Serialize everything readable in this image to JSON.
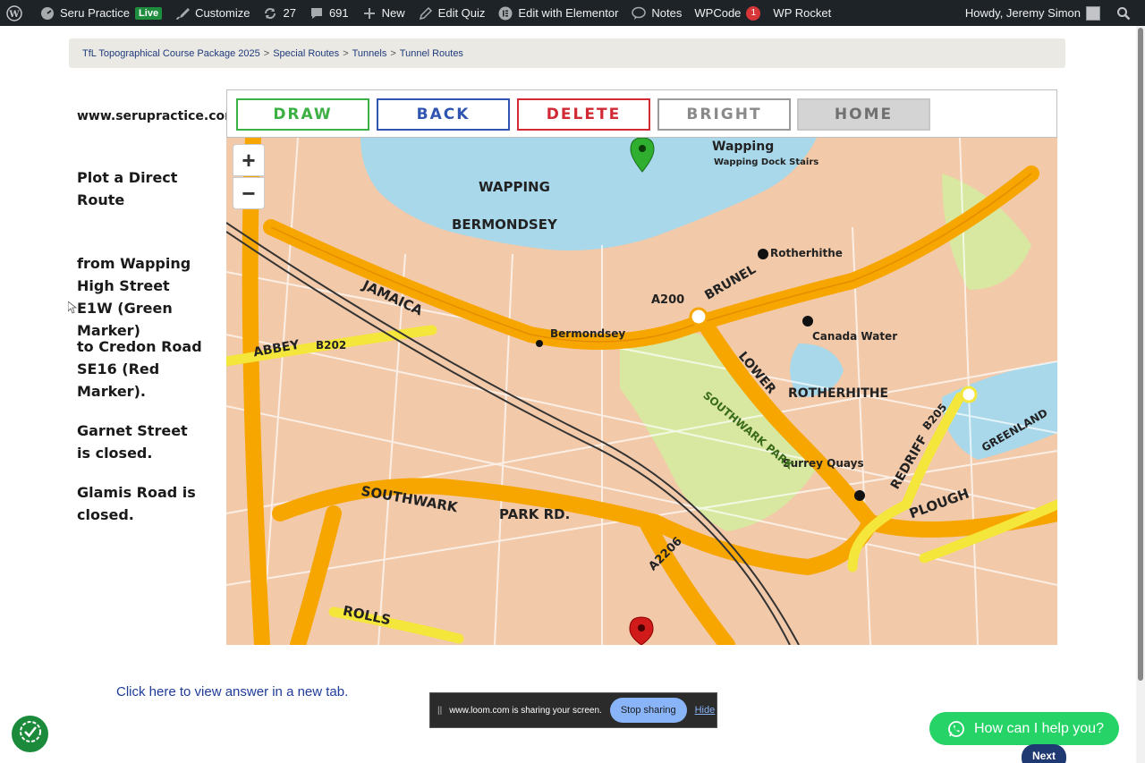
{
  "adminbar": {
    "items": [
      {
        "icon": "wordpress-icon",
        "label": ""
      },
      {
        "icon": "dashboard-icon",
        "label": "Seru Practice",
        "badge": "Live"
      },
      {
        "icon": "brush-icon",
        "label": "Customize"
      },
      {
        "icon": "updates-icon",
        "label": "27"
      },
      {
        "icon": "comment-icon",
        "label": "691"
      },
      {
        "icon": "plus-icon",
        "label": "New"
      },
      {
        "icon": "pencil-icon",
        "label": "Edit Quiz"
      },
      {
        "icon": "elementor-icon",
        "label": "Edit with Elementor"
      },
      {
        "icon": "notes-icon",
        "label": "Notes"
      },
      {
        "icon": "",
        "label": "WPCode",
        "badge": "1"
      },
      {
        "icon": "",
        "label": "WP Rocket"
      }
    ],
    "greeting": "Howdy, Jeremy Simon"
  },
  "breadcrumb": [
    "TfL Topographical Course Package 2025",
    "Special Routes",
    "Tunnels",
    "Tunnel Routes"
  ],
  "left": {
    "site_url": "www.serupractice.com",
    "instruction": "Plot a Direct Route",
    "from": "from Wapping High Street E1W (Green Marker)",
    "to": "to Credon Road SE16 (Red Marker).",
    "closure1": "Garnet Street is closed.",
    "closure2": "Glamis Road is closed."
  },
  "toolbar": {
    "draw": "DRAW",
    "back": "BACK",
    "delete": "DELETE",
    "bright": "BRIGHT",
    "home": "HOME"
  },
  "map": {
    "zoom_in": "+",
    "zoom_out": "−",
    "labels": {
      "wapping_station": "Wapping",
      "wapping_dock": "Wapping Dock Stairs",
      "wapping_area": "WAPPING",
      "bermondsey_area": "BERMONDSEY",
      "rotherhithe_station": "Rotherhithe",
      "canada_water": "Canada Water",
      "rotherhithe_area": "ROTHERHITHE",
      "bermondsey_station": "Bermondsey",
      "southwark_park": "SOUTHWARK PARK",
      "surrey_quays": "Surrey Quays",
      "lower_road": "LOWER",
      "abbey_st": "ABBEY",
      "jamaica_rd": "JAMAICA",
      "southwark_rd": "SOUTHWARK",
      "park_rd": "PARK RD.",
      "plough": "PLOUGH",
      "road_a200": "A200",
      "road_b202": "B202",
      "road_a2206": "A2206",
      "road_b205": "B205",
      "rolls": "ROLLS",
      "redriff": "REDRIFF",
      "greenland": "GREENLAND",
      "brunel": "BRUNEL"
    }
  },
  "answer_link": "Click here to view answer in a new tab.",
  "loom": {
    "message": "www.loom.com is sharing your screen.",
    "stop": "Stop sharing",
    "hide": "Hide"
  },
  "whatsapp": "How can I help you?",
  "next": "Next",
  "colors": {
    "draw": "#3cb043",
    "back": "#2f55b0",
    "delete": "#d12a35",
    "water": "#a8d8ea",
    "park": "#d8e8a0",
    "major_road": "#f7a600",
    "minor_road": "#f5e63c"
  }
}
